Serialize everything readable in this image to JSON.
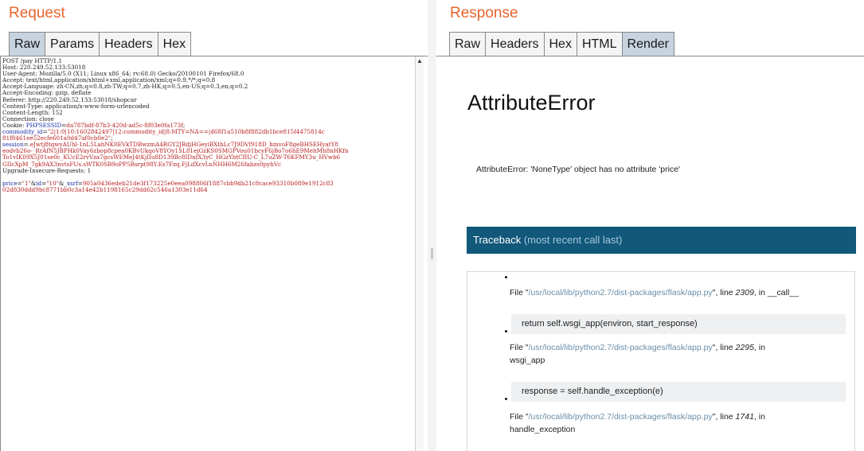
{
  "request": {
    "title": "Request",
    "tabs": [
      "Raw",
      "Params",
      "Headers",
      "Hex"
    ],
    "active_tab": "Raw",
    "raw_lines": [
      [
        {
          "t": "POST /pay HTTP/1.1",
          "c": ""
        }
      ],
      [
        {
          "t": "Host: 220.249.52.133:53018",
          "c": ""
        }
      ],
      [
        {
          "t": "User-Agent: Mozilla/5.0 (X11; Linux x86_64; rv:68.0) Gecko/20100101 Firefox/68.0",
          "c": ""
        }
      ],
      [
        {
          "t": "Accept: text/html,application/xhtml+xml,application/xml;q=0.9,*/*;q=0.8",
          "c": ""
        }
      ],
      [
        {
          "t": "Accept-Language: zh-CN,zh;q=0.8,zh-TW;q=0.7,zh-HK;q=0.5,en-US;q=0.3,en;q=0.2",
          "c": ""
        }
      ],
      [
        {
          "t": "Accept-Encoding: gzip, deflate",
          "c": ""
        }
      ],
      [
        {
          "t": "Referer: http://220.249.52.133:53018/shopcar",
          "c": ""
        }
      ],
      [
        {
          "t": "Content-Type: application/x-www-form-urlencoded",
          "c": ""
        }
      ],
      [
        {
          "t": "Content-Length: 152",
          "c": ""
        }
      ],
      [
        {
          "t": "Connection: close",
          "c": ""
        }
      ],
      [
        {
          "t": "Cookie: ",
          "c": ""
        },
        {
          "t": "PHPSESSID",
          "c": "blue"
        },
        {
          "t": "=",
          "c": ""
        },
        {
          "t": "da787bdf-87b3-420d-ad5c-8f03e0fa173f",
          "c": "red"
        },
        {
          "t": ";",
          "c": ""
        }
      ],
      [
        {
          "t": "commodity_id",
          "c": "blue"
        },
        {
          "t": "=",
          "c": ""
        },
        {
          "t": "\"2|1:0|10:1602842497|12:commodity_id|8:MTY=NA==|d68f1a510b8f882db1bce815f4475814c",
          "c": "red"
        }
      ],
      [
        {
          "t": "81f8461ee52ecfe601a0d47af0cb0e2\"",
          "c": "red"
        },
        {
          "t": ";",
          "c": ""
        }
      ],
      [
        {
          "t": "session",
          "c": "blue"
        },
        {
          "t": "=",
          "c": ""
        },
        {
          "t": ".eJwtj8tqwyAUhl-1nL5LahNK0EVkTDBwzmA4RGY2JRdjHGeyiBXthLc7J9DVf918D_hmvoF8geBHSEHyatY8",
          "c": "red"
        }
      ],
      [
        {
          "t": "eodvb26o-_RrAfN5JBPHk0Vay6zbop8cpea0KBvUkqoV8YOy1SL81ejGzKS0SMGPVou01bcyF6jBo7o6hE9MehMh8nHKfn",
          "c": "red"
        }
      ],
      [
        {
          "t": "To1vIK09X5J01se0c_KUcE2rvVza7gcsWEMeJ4tKjIIu8D139Bc8IDnfX3yC_HGzYbtCfIU-C_L7uZW-T6KFMY3u_HVwb6",
          "c": "red"
        }
      ],
      [
        {
          "t": "GIIcXpM_7gk9AX3nvtsFUs.sWTK0SB9oPP5Bsrpt98Y.Es7Fzq.FjLdXcvLnNHH6M26fabzs0pyhVc",
          "c": "red"
        }
      ],
      [
        {
          "t": "Upgrade-Insecure-Requests: 1",
          "c": ""
        }
      ],
      [
        {
          "t": "",
          "c": ""
        }
      ],
      [
        {
          "t": "price",
          "c": "blue"
        },
        {
          "t": "=",
          "c": ""
        },
        {
          "t": "\"1\"",
          "c": "red"
        },
        {
          "t": "&",
          "c": ""
        },
        {
          "t": "id",
          "c": "blue"
        },
        {
          "t": "=",
          "c": ""
        },
        {
          "t": "\"10\"",
          "c": "red"
        },
        {
          "t": "&",
          "c": ""
        },
        {
          "t": "_xsrf",
          "c": "blue"
        },
        {
          "t": "=",
          "c": ""
        },
        {
          "t": "905a0436edeb21de3f173225e0eea098806f1887cbb9db21c8cace93310b089e1912c83",
          "c": "red"
        }
      ],
      [
        {
          "t": "02d830ddd9bc8771bb0c3a14e42b1198165c29dd62c546a1303e11d64",
          "c": "red"
        }
      ]
    ]
  },
  "response": {
    "title": "Response",
    "tabs": [
      "Raw",
      "Headers",
      "Hex",
      "HTML",
      "Render"
    ],
    "active_tab": "Render",
    "error_title": "AttributeError",
    "error_message": "AttributeError: 'NoneType' object has no attribute 'price'",
    "traceback_header": "Traceback",
    "traceback_sub": "(most recent call last)",
    "frames": [
      {
        "file_prefix": "File \"",
        "path": "/usr/local/lib/python2.7/dist-packages/flask/app.py",
        "line_prefix": "\", line ",
        "line": "2309",
        "in_prefix": ", in ",
        "func": "__call__",
        "code": "return self.wsgi_app(environ, start_response)"
      },
      {
        "file_prefix": "File \"",
        "path": "/usr/local/lib/python2.7/dist-packages/flask/app.py",
        "line_prefix": "\", line ",
        "line": "2295",
        "in_prefix": ", in",
        "func": "wsgi_app",
        "code": "response = self.handle_exception(e)"
      },
      {
        "file_prefix": "File \"",
        "path": "/usr/local/lib/python2.7/dist-packages/flask/app.py",
        "line_prefix": "\", line ",
        "line": "1741",
        "in_prefix": ", in",
        "func": "handle_exception",
        "code": ""
      }
    ]
  }
}
